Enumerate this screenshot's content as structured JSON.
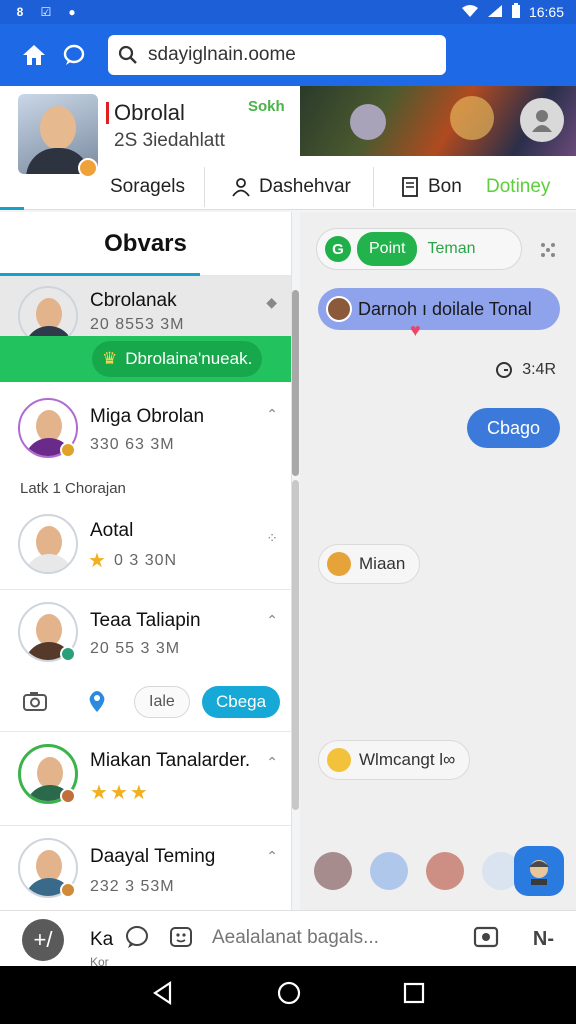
{
  "status_bar": {
    "time": "16:65",
    "left_icons": [
      "notification-icon",
      "checkbox-icon",
      "record-icon"
    ],
    "right_icons": [
      "wifi-icon",
      "signal-icon",
      "battery-icon"
    ]
  },
  "app_bar": {
    "search": {
      "value": "sdayiglnain.oome",
      "placeholder": ""
    },
    "icons": [
      "home-icon",
      "chat-icon",
      "settings-icon",
      "microphone-icon"
    ],
    "color": "#1e6ae6"
  },
  "profile": {
    "name": "Obrolal",
    "subtitle": "2S 3iedahlatt",
    "tag": "Sokh",
    "tabs": [
      {
        "label": "Soragels",
        "icon": ""
      },
      {
        "label": "Dashehvar",
        "icon": "person-icon"
      },
      {
        "label": "Bon",
        "icon": "book-icon"
      },
      {
        "label": "Dotiney",
        "icon": ""
      }
    ]
  },
  "left_panel": {
    "title": "Obvars",
    "section_label": "Latk 1 Chorajan",
    "chats": [
      {
        "name": "Cbrolanak",
        "time": "20 8553 3M"
      },
      {
        "name": "Miga Obrolan",
        "time": "330 63 3M"
      },
      {
        "name": "Aotal",
        "time": "0 3 30N"
      },
      {
        "name": "Teaa Taliapin",
        "time": "20 55 3 3M"
      },
      {
        "name": "Miakan Tanalarder.",
        "time": ""
      },
      {
        "name": "Daayal Teming",
        "time": "232 3 53M"
      }
    ],
    "selected_banner": "Dbrolaina'nueak.",
    "chip_gray": "Iale",
    "chip_blue": "Cbega",
    "stars_rating": 3,
    "star_counts": {
      "aotal": 1,
      "miakan": 3
    }
  },
  "right_panel": {
    "segment": {
      "g_label": "G",
      "active": "Point",
      "inactive": "Teman"
    },
    "incoming_blue": "Darnoh ı doilale Tonal",
    "meta": "3:4R",
    "outgoing": "Cbago",
    "incoming_1": "Miaan",
    "incoming_2": "Wlmcangt l∞"
  },
  "compose": {
    "fab_label": "+/",
    "user_short": "Ka",
    "user_sub": "Kor",
    "placeholder": "Aealalanat bagals...",
    "extra": "N-"
  }
}
